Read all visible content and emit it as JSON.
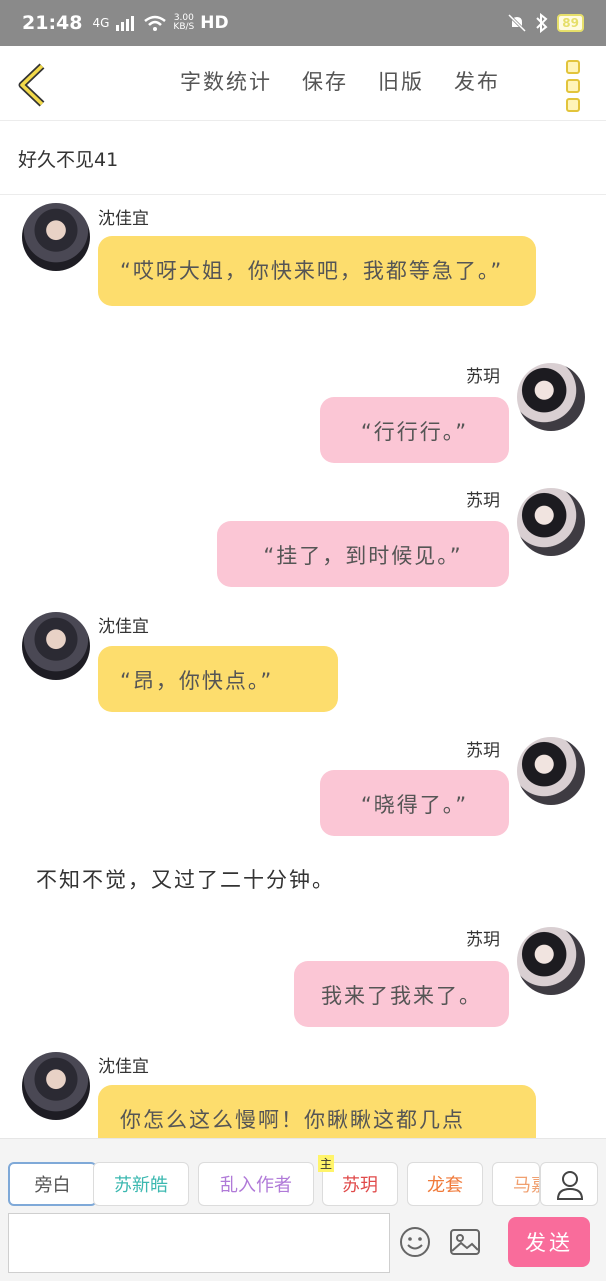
{
  "status": {
    "time": "21:48",
    "network": "4G",
    "speed": "3.00",
    "speed_unit": "KB/S",
    "hd": "HD",
    "battery": "89"
  },
  "topbar": {
    "menu": [
      "字数统计",
      "保存",
      "旧版",
      "发布"
    ]
  },
  "chapter_title": "好久不见41",
  "messages": [
    {
      "side": "left",
      "name": "沈佳宜",
      "text": "“哎呀大姐，你快来吧，我都等急了。”"
    },
    {
      "side": "right",
      "name": "苏玥",
      "text": "“行行行。”"
    },
    {
      "side": "right",
      "name": "苏玥",
      "text": "“挂了，到时候见。”"
    },
    {
      "side": "left",
      "name": "沈佳宜",
      "text": "“昂，你快点。”"
    },
    {
      "side": "right",
      "name": "苏玥",
      "text": "“晓得了。”"
    },
    {
      "side": "narration",
      "text": "不知不觉，又过了二十分钟。"
    },
    {
      "side": "right",
      "name": "苏玥",
      "text": "我来了我来了。"
    },
    {
      "side": "left",
      "name": "沈佳宜",
      "text": "你怎么这么慢啊！你瞅瞅这都几点"
    }
  ],
  "characters": {
    "list": [
      "旁白",
      "苏新皓",
      "乱入作者",
      "苏玥",
      "龙套",
      "马嘉"
    ],
    "colors": [
      "#555555",
      "#3bb8b0",
      "#b07ad8",
      "#e04a4a",
      "#f07a3a",
      "#f0a070"
    ],
    "main_badge": "主"
  },
  "composer": {
    "input_value": "",
    "send_label": "发送"
  },
  "colors": {
    "yellow_bubble": "#fddd6d",
    "pink_bubble": "#fbc6d5",
    "accent": "#f96c9b"
  }
}
